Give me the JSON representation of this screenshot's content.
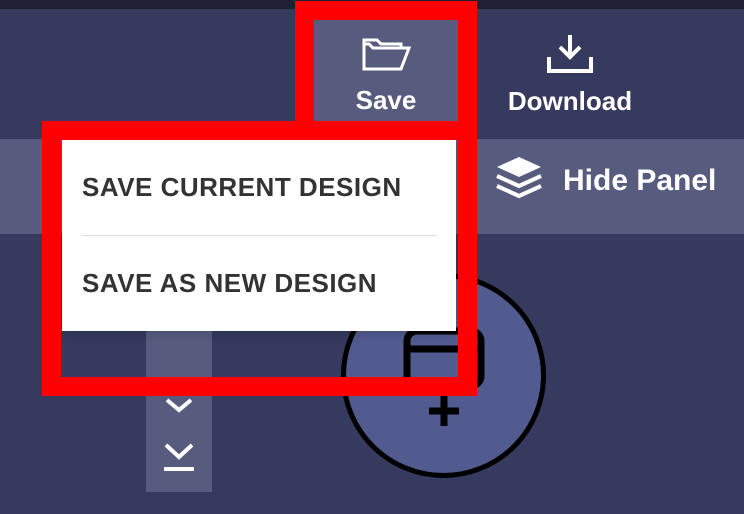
{
  "toolbar": {
    "save_label": "Save",
    "download_label": "Download"
  },
  "secondary": {
    "hide_panel_label": "Hide Panel"
  },
  "dropdown": {
    "item1": "SAVE CURRENT DESIGN",
    "item2": "SAVE AS NEW DESIGN"
  }
}
